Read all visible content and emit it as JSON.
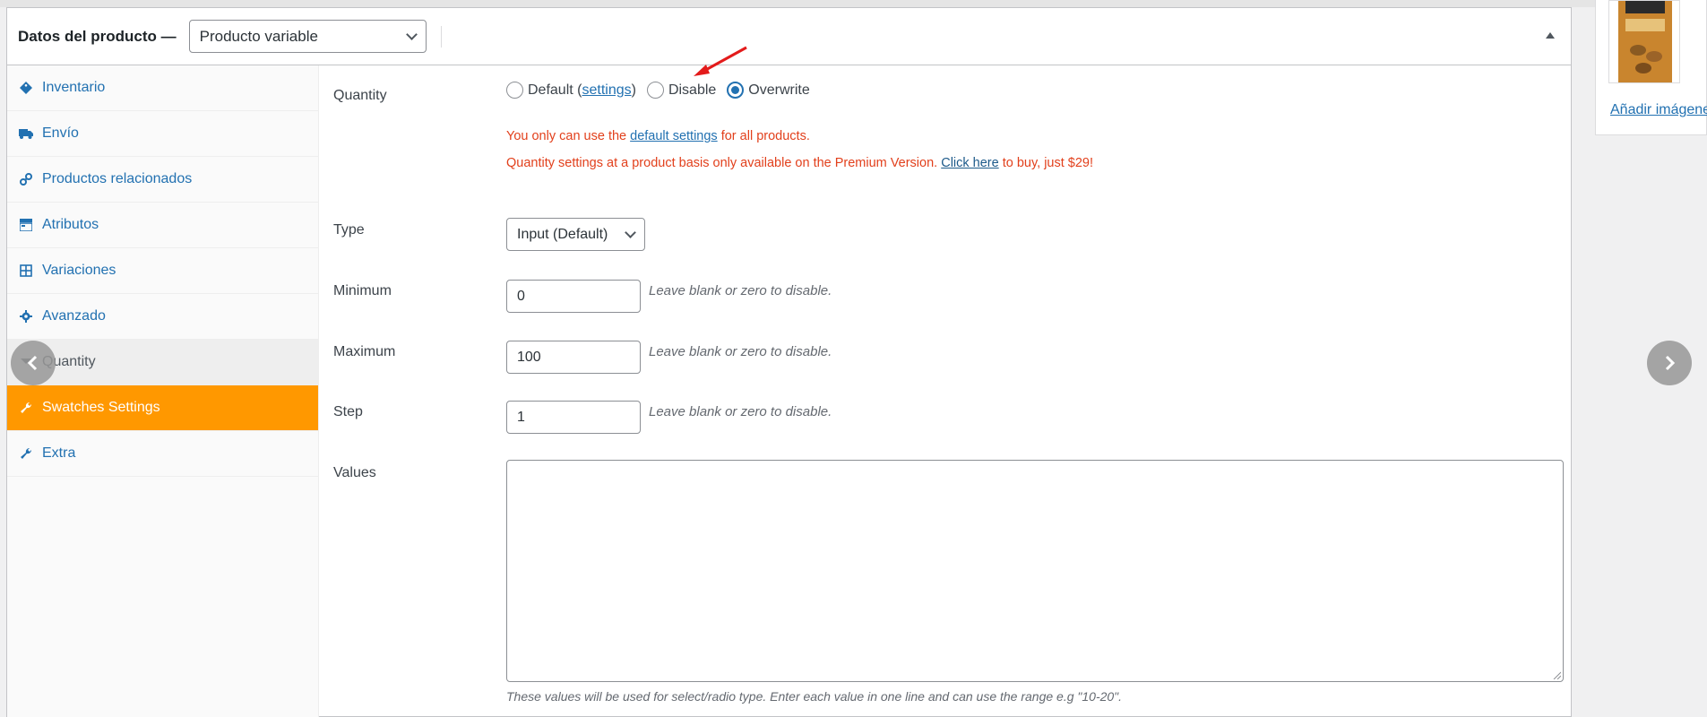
{
  "header": {
    "title": "Datos del producto —",
    "product_type": "Producto variable"
  },
  "tabs": [
    {
      "label": "Inventario",
      "icon": "tag-icon"
    },
    {
      "label": "Envío",
      "icon": "truck-icon"
    },
    {
      "label": "Productos relacionados",
      "icon": "link-icon"
    },
    {
      "label": "Atributos",
      "icon": "table-icon"
    },
    {
      "label": "Variaciones",
      "icon": "grid-icon"
    },
    {
      "label": "Avanzado",
      "icon": "gear-icon"
    },
    {
      "label": "Quantity",
      "icon": "sort-icon"
    },
    {
      "label": "Swatches Settings",
      "icon": "wrench-icon"
    },
    {
      "label": "Extra",
      "icon": "wrench-icon"
    }
  ],
  "quantity": {
    "label": "Quantity",
    "opt_default": "Default (",
    "opt_default_link": "settings",
    "opt_default_close": ")",
    "opt_disable": "Disable",
    "opt_overwrite": "Overwrite",
    "selected": "Overwrite",
    "notice1_pre": "You only can use the ",
    "notice1_link": "default settings",
    "notice1_post": " for all products.",
    "notice2_pre": "Quantity settings at a product basis only available on the Premium Version. ",
    "notice2_link": "Click here",
    "notice2_post": " to buy, just $29!"
  },
  "type": {
    "label": "Type",
    "value": "Input (Default)"
  },
  "minimum": {
    "label": "Minimum",
    "value": "0",
    "hint": "Leave blank or zero to disable."
  },
  "maximum": {
    "label": "Maximum",
    "value": "100",
    "hint": "Leave blank or zero to disable."
  },
  "step": {
    "label": "Step",
    "value": "1",
    "hint": "Leave blank or zero to disable."
  },
  "values": {
    "label": "Values",
    "description": "These values will be used for select/radio type. Enter each value in one line and can use the range e.g \"10-20\"."
  },
  "sidebar": {
    "add_images": "Añadir imágenes"
  },
  "colors": {
    "accent": "#2271b1",
    "highlight": "#ff9800",
    "notice": "#e2401c"
  }
}
